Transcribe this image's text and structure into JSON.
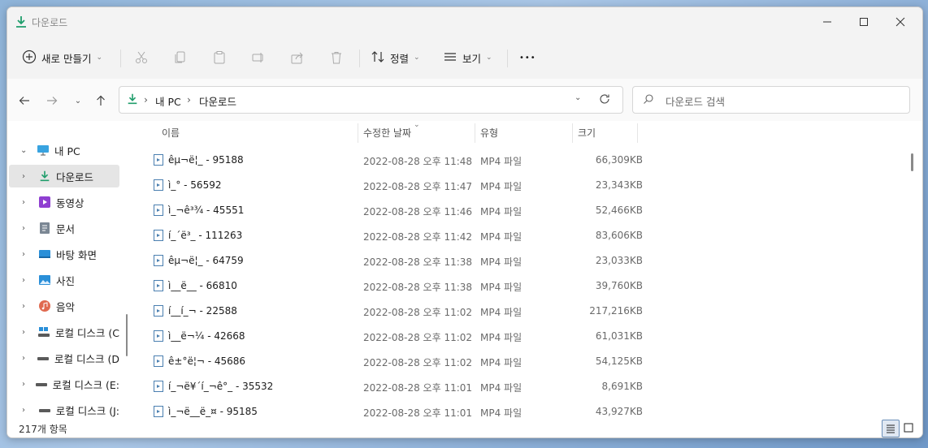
{
  "window": {
    "title": "다운로드"
  },
  "toolbar": {
    "new_label": "새로 만들기",
    "sort_label": "정렬",
    "view_label": "보기",
    "more_label": "•••"
  },
  "address": {
    "crumbs": [
      "내 PC",
      "다운로드"
    ],
    "search_placeholder": "다운로드 검색"
  },
  "sidebar": {
    "items": [
      {
        "label": "내 PC",
        "icon": "monitor-icon",
        "expander": "⌄"
      },
      {
        "label": "다운로드",
        "icon": "download-icon",
        "expander": "›"
      },
      {
        "label": "동영상",
        "icon": "video-icon",
        "expander": "›"
      },
      {
        "label": "문서",
        "icon": "document-icon",
        "expander": "›"
      },
      {
        "label": "바탕 화면",
        "icon": "desktop-icon",
        "expander": "›"
      },
      {
        "label": "사진",
        "icon": "pictures-icon",
        "expander": "›"
      },
      {
        "label": "음악",
        "icon": "music-icon",
        "expander": "›"
      },
      {
        "label": "로컬 디스크 (C",
        "icon": "system-drive-icon",
        "expander": "›"
      },
      {
        "label": "로컬 디스크 (D",
        "icon": "drive-icon",
        "expander": "›"
      },
      {
        "label": "로컬 디스크 (E:",
        "icon": "drive-icon",
        "expander": "›"
      },
      {
        "label": "로컬 디스크 (J:",
        "icon": "drive-icon",
        "expander": "›"
      }
    ]
  },
  "columns": {
    "name": "이름",
    "date": "수정한 날짜",
    "type": "유형",
    "size": "크기"
  },
  "files": [
    {
      "name": "êµ¬ë¦_ - 95188",
      "date": "2022-08-28 오후 11:48",
      "type": "MP4 파일",
      "size": "66,309KB"
    },
    {
      "name": "ì_° - 56592",
      "date": "2022-08-28 오후 11:47",
      "type": "MP4 파일",
      "size": "23,343KB"
    },
    {
      "name": "ì_¬ê³¾ - 45551",
      "date": "2022-08-28 오후 11:46",
      "type": "MP4 파일",
      "size": "52,466KB"
    },
    {
      "name": "í_´ë³_ - 111263",
      "date": "2022-08-28 오후 11:42",
      "type": "MP4 파일",
      "size": "83,606KB"
    },
    {
      "name": "êµ¬ë¦_ - 64759",
      "date": "2022-08-28 오후 11:38",
      "type": "MP4 파일",
      "size": "23,033KB"
    },
    {
      "name": "ì__ë__ - 66810",
      "date": "2022-08-28 오후 11:38",
      "type": "MP4 파일",
      "size": "39,760KB"
    },
    {
      "name": "í__í_¬ - 22588",
      "date": "2022-08-28 오후 11:02",
      "type": "MP4 파일",
      "size": "217,216KB"
    },
    {
      "name": "ì__ë¬¼ - 42668",
      "date": "2022-08-28 오후 11:02",
      "type": "MP4 파일",
      "size": "61,031KB"
    },
    {
      "name": "ê±°ë¦¬ - 45686",
      "date": "2022-08-28 오후 11:02",
      "type": "MP4 파일",
      "size": "54,125KB"
    },
    {
      "name": "í_¬ë¥´í_¬ê°_ - 35532",
      "date": "2022-08-28 오후 11:01",
      "type": "MP4 파일",
      "size": "8,691KB"
    },
    {
      "name": "ì_¬ë__ë_¤ - 95185",
      "date": "2022-08-28 오후 11:01",
      "type": "MP4 파일",
      "size": "43,927KB"
    }
  ],
  "status": {
    "count_text": "217개 항목"
  },
  "colors": {
    "accent": "#0f9d58",
    "selected": "#e5e5e5"
  }
}
